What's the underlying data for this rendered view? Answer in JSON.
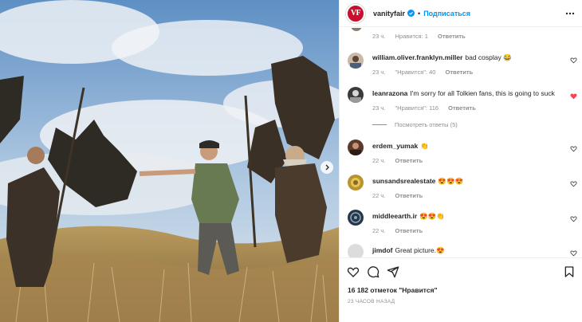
{
  "header": {
    "logo_text": "VF",
    "username": "vanityfair",
    "separator": "•",
    "follow_label": "Подписаться",
    "brand_color": "#c8102e",
    "accent_color": "#0095f6"
  },
  "top_meta": {
    "time": "23 ч.",
    "likes": "Нравится: 1",
    "reply": "Ответить"
  },
  "comments": [
    {
      "user": "william.oliver.franklyn.miller",
      "text": "bad cosplay 😂",
      "time": "23 ч.",
      "likes": "\"Нравится\": 40",
      "reply": "Ответить",
      "liked": false
    },
    {
      "user": "leanrazona",
      "text": "I'm sorry for all Tolkien fans, this is going to suck",
      "time": "23 ч.",
      "likes": "\"Нравится\": 116",
      "reply": "Ответить",
      "liked": true,
      "view_replies": "Посмотреть ответы (5)"
    },
    {
      "user": "erdem_yumak",
      "text": "👏",
      "time": "22 ч.",
      "reply": "Ответить",
      "liked": false
    },
    {
      "user": "sunsandsrealestate",
      "text": "😍😍😍",
      "time": "22 ч.",
      "reply": "Ответить",
      "liked": false
    },
    {
      "user": "middleearth.ir",
      "text": "😍😍👏",
      "time": "22 ч.",
      "reply": "Ответить",
      "liked": false
    },
    {
      "user": "jimdof",
      "text": "Great picture.😍",
      "time": "",
      "reply": "",
      "liked": false
    }
  ],
  "footer": {
    "likes_count": "16 182 отметок \"Нравится\"",
    "posted_ago": "23 ЧАСОВ НАЗАД"
  },
  "icons": [
    "like-icon",
    "comment-icon",
    "share-icon",
    "save-icon",
    "more-icon",
    "verified-icon",
    "chevron-right-icon"
  ]
}
